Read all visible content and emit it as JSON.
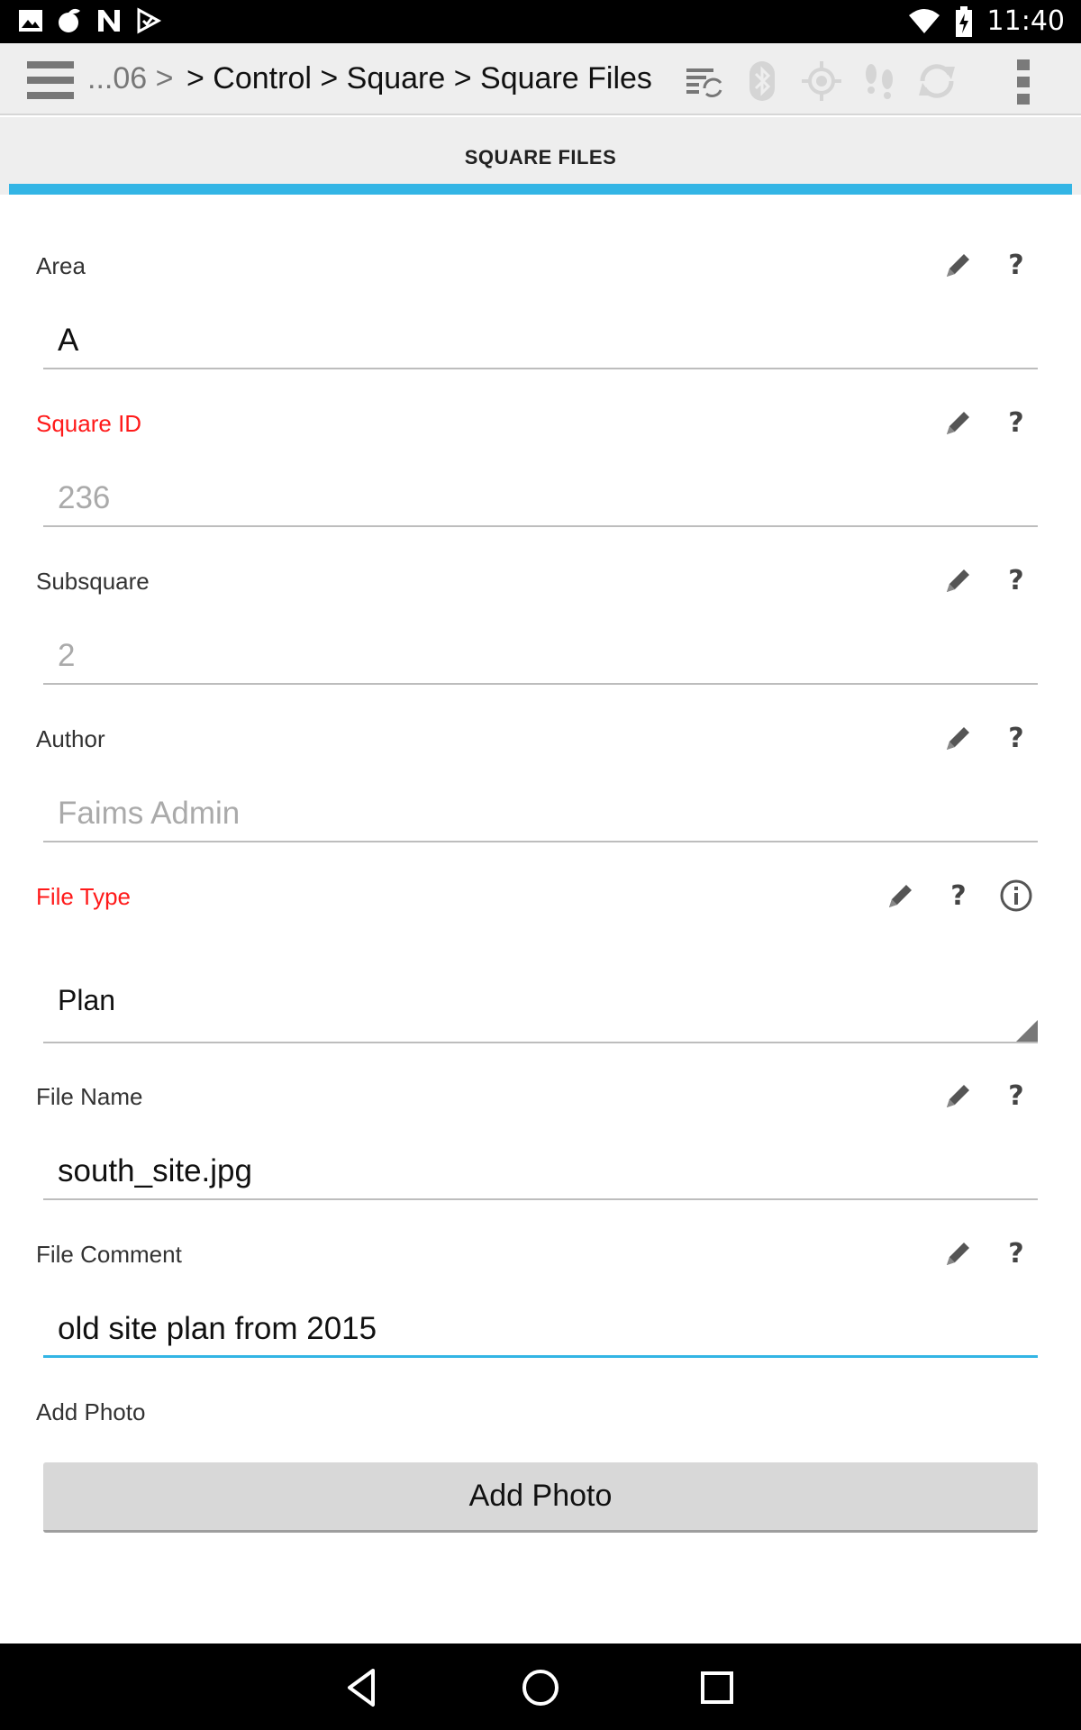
{
  "status_bar": {
    "time": "11:40",
    "left_icons": [
      "image-notification-icon",
      "app-notification-icon",
      "n-notification-icon",
      "check-notification-icon"
    ],
    "right_icons": [
      "wifi-icon",
      "battery-charging-icon"
    ]
  },
  "action_bar": {
    "breadcrumb_truncated": "...06 >",
    "breadcrumb_path": "> Control > Square > Square Files",
    "icons": [
      "sync-list-icon",
      "bluetooth-icon",
      "gps-icon",
      "footsteps-icon",
      "refresh-icon",
      "overflow-menu-icon"
    ]
  },
  "tabs": [
    {
      "label": "SQUARE FILES",
      "selected": true
    }
  ],
  "form": {
    "fields": [
      {
        "label": "Area",
        "required": false,
        "value": "A",
        "state": "enabled"
      },
      {
        "label": "Square ID",
        "required": true,
        "value": "236",
        "state": "disabled"
      },
      {
        "label": "Subsquare",
        "required": false,
        "value": "2",
        "state": "disabled"
      },
      {
        "label": "Author",
        "required": false,
        "value": "Faims Admin",
        "state": "disabled"
      },
      {
        "label": "File Type",
        "required": true,
        "value": "Plan",
        "state": "select"
      },
      {
        "label": "File Name",
        "required": false,
        "value": "south_site.jpg",
        "state": "enabled"
      },
      {
        "label": "File Comment",
        "required": false,
        "value": "old site plan from 2015",
        "state": "focused"
      }
    ],
    "photo": {
      "label": "Add Photo",
      "button_label": "Add Photo"
    },
    "help_glyph": "?"
  },
  "colors": {
    "accent": "#33b5e5",
    "required_label": "#ff1a1a",
    "disabled_text": "#aaaaaa"
  },
  "nav_bar": {
    "buttons": [
      "back-icon",
      "home-icon",
      "recents-icon"
    ]
  }
}
